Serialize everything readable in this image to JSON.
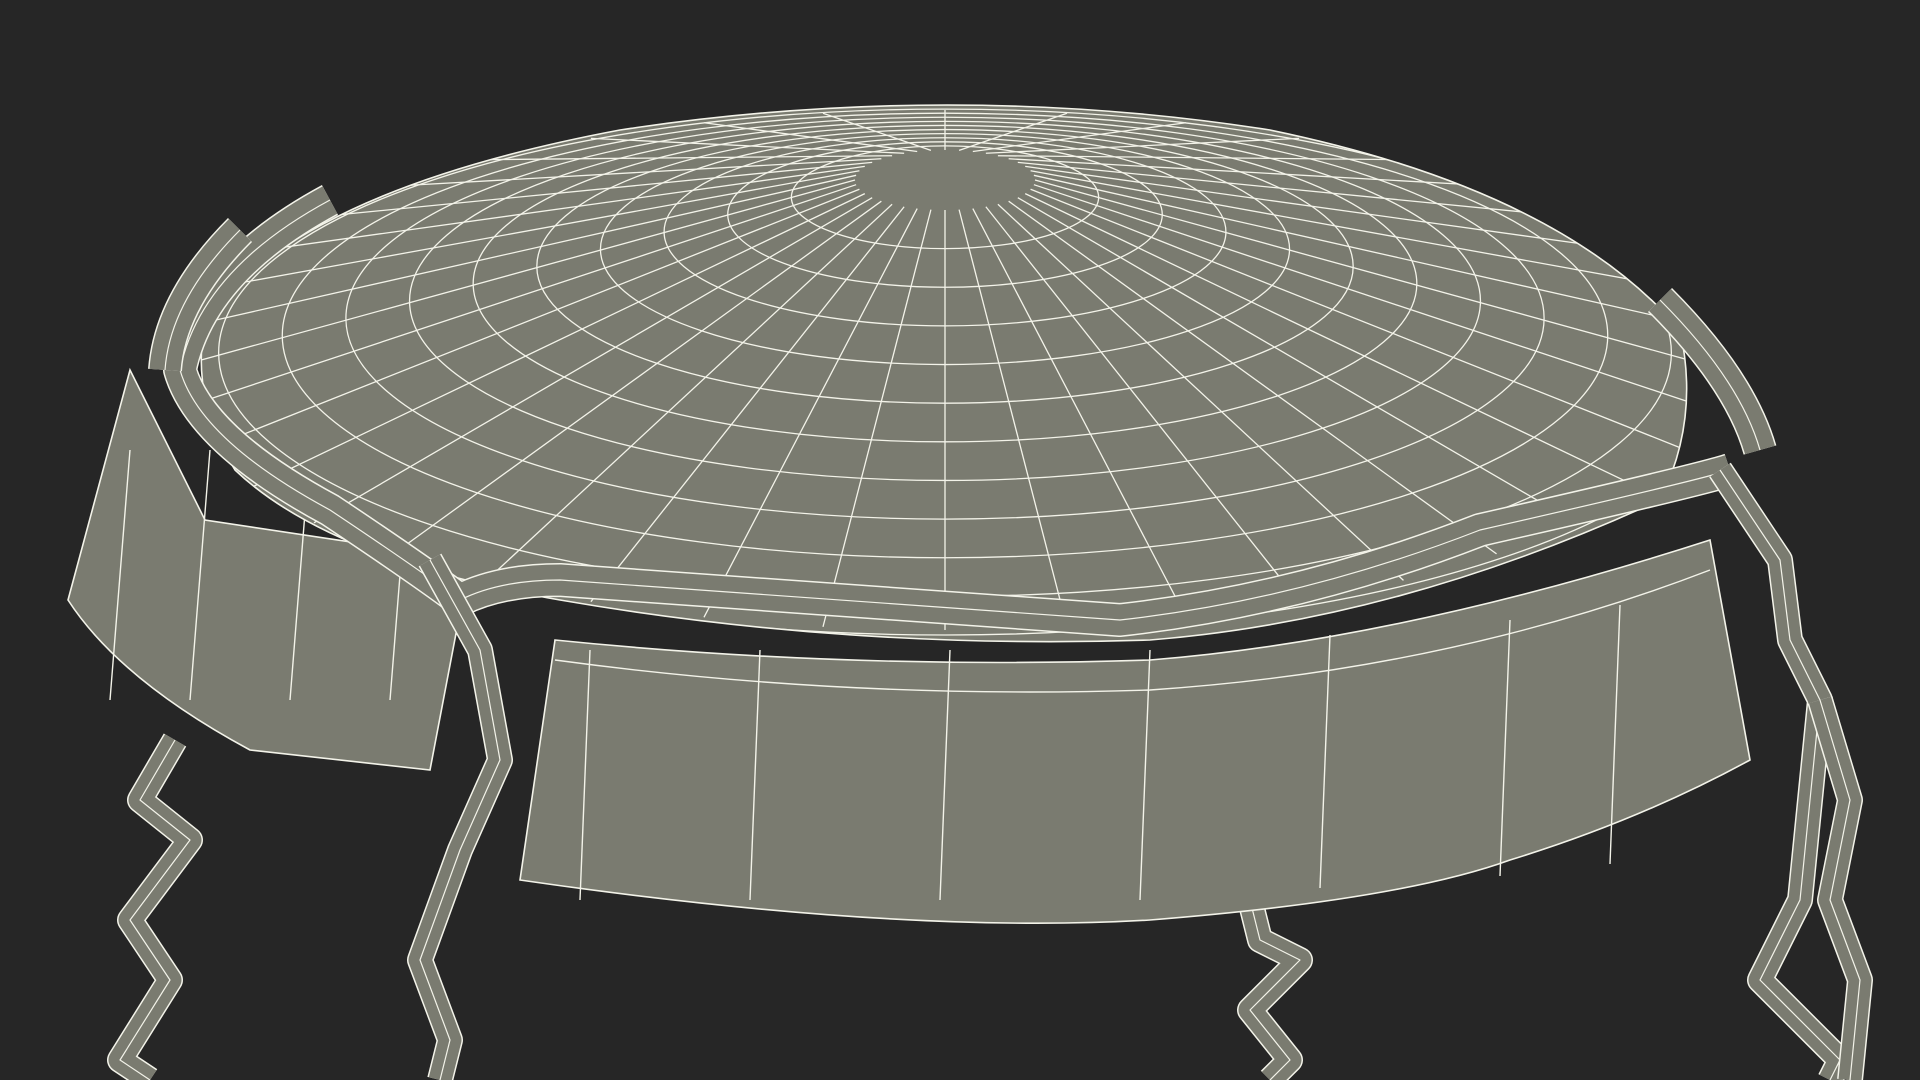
{
  "scene": {
    "subject": "wireframe-bottle-cap",
    "colors": {
      "background": "#262626",
      "surface": "#7a7b70",
      "surface_dark": "#5f6058",
      "surface_shadow": "#3a3a36",
      "wire": "#f3f3e9"
    }
  }
}
